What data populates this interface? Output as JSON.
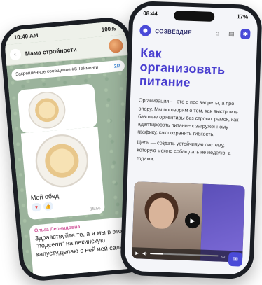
{
  "left_phone": {
    "status": {
      "time": "10:40 AM",
      "battery": "100%"
    },
    "header": {
      "title": "Мама стройности",
      "subtitle": "",
      "back_icon": "chevron-left-icon"
    },
    "pinned": {
      "text": "Закреплённое сообщение #8 Тайминги",
      "count": "2/7"
    },
    "message_caption": {
      "text": "Мой обед",
      "time": "15:56"
    },
    "reply": {
      "author": "Ольга Леонидовна",
      "text": "Здравствуйте,те, а я мы в этот \"подсели\" на пекинскую капусту,делаю с ней ней салаты"
    },
    "reactions": [
      "heart",
      "thumbs-up"
    ]
  },
  "right_phone": {
    "status": {
      "time": "08:44",
      "battery": "17%"
    },
    "nav": {
      "brand": "СОЗВЕЗДИЕ"
    },
    "heading": "Как организовать питание",
    "paragraph1": "Организация — это о про запреты, а про опору. Мы поговорим о том, как выстроить базовые ориентиры без строгих рамок, как адаптировать питание к загруженному графику, как сохранить гибкость.",
    "paragraph2": "Цель — создать устойчивую систему, которую можно соблюдать не неделю, а годами.",
    "video": {
      "progress": 0.18
    },
    "colors": {
      "accent": "#4a3fd0",
      "brand": "#4a4ad8"
    }
  }
}
